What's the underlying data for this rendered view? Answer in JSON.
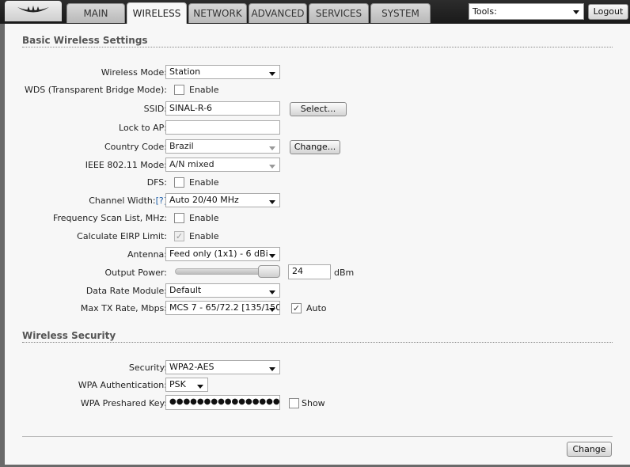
{
  "nav": {
    "tabs": [
      "MAIN",
      "WIRELESS",
      "NETWORK",
      "ADVANCED",
      "SERVICES",
      "SYSTEM"
    ],
    "active_tab": "WIRELESS",
    "tools_label": "Tools:",
    "logout_label": "Logout"
  },
  "basic": {
    "title": "Basic Wireless Settings",
    "wireless_mode": {
      "label": "Wireless Mode:",
      "value": "Station"
    },
    "wds": {
      "label": "WDS (Transparent Bridge Mode):",
      "checkbox_label": "Enable",
      "checked": false
    },
    "ssid": {
      "label": "SSID:",
      "value": "SINAL-R-6",
      "button": "Select..."
    },
    "lock_ap": {
      "label": "Lock to AP:",
      "value": ""
    },
    "country": {
      "label": "Country Code:",
      "value": "Brazil",
      "button": "Change..."
    },
    "ieee_mode": {
      "label": "IEEE 802.11 Mode:",
      "value": "A/N mixed"
    },
    "dfs": {
      "label": "DFS:",
      "checkbox_label": "Enable",
      "checked": false
    },
    "channel_width": {
      "label": "Channel Width:",
      "help": "[?]",
      "value": "Auto 20/40 MHz"
    },
    "freq_scan": {
      "label": "Frequency Scan List, MHz:",
      "checkbox_label": "Enable",
      "checked": false
    },
    "eirp": {
      "label": "Calculate EIRP Limit:",
      "checkbox_label": "Enable",
      "checked": true
    },
    "antenna": {
      "label": "Antenna:",
      "value": "Feed only (1x1) - 6 dBi"
    },
    "output_power": {
      "label": "Output Power:",
      "value": "24",
      "unit": "dBm"
    },
    "data_rate": {
      "label": "Data Rate Module:",
      "value": "Default"
    },
    "max_tx": {
      "label": "Max TX Rate, Mbps:",
      "value": "MCS 7 - 65/72.2 [135/150",
      "auto_label": "Auto",
      "auto_checked": true
    }
  },
  "security": {
    "title": "Wireless Security",
    "security": {
      "label": "Security:",
      "value": "WPA2-AES"
    },
    "wpa_auth": {
      "label": "WPA Authentication:",
      "value": "PSK"
    },
    "wpa_key": {
      "label": "WPA Preshared Key:",
      "value": "●●●●●●●●●●●●●●●●●●●●●",
      "show_label": "Show",
      "show_checked": false
    }
  },
  "footer": {
    "change_label": "Change"
  }
}
